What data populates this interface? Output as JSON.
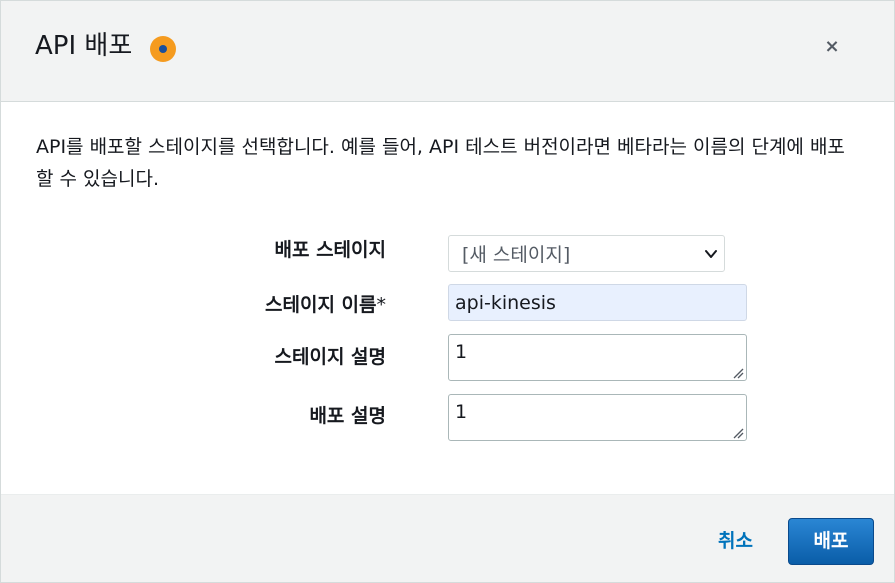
{
  "header": {
    "title": "API 배포",
    "close_label": "×"
  },
  "body": {
    "description": "API를 배포할 스테이지를 선택합니다. 예를 들어, API 테스트 버전이라면 베타라는 이름의 단계에 배포할 수 있습니다."
  },
  "form": {
    "deploy_stage": {
      "label": "배포 스테이지",
      "value": "[새 스테이지]"
    },
    "stage_name": {
      "label": "스테이지 이름",
      "required_mark": "*",
      "value": "api-kinesis"
    },
    "stage_description": {
      "label": "스테이지 설명",
      "value": "1"
    },
    "deployment_description": {
      "label": "배포 설명",
      "value": "1"
    }
  },
  "footer": {
    "cancel_label": "취소",
    "submit_label": "배포"
  },
  "colors": {
    "accent": "#0073bb",
    "primary_button": "#1a6fc2",
    "info_badge": "#f59b1f",
    "autofill_background": "#e8f0fe"
  },
  "icons": {
    "info": "info-badge-icon",
    "close": "close-icon",
    "dropdown": "chevron-down-icon",
    "resize": "resize-grip-icon"
  }
}
